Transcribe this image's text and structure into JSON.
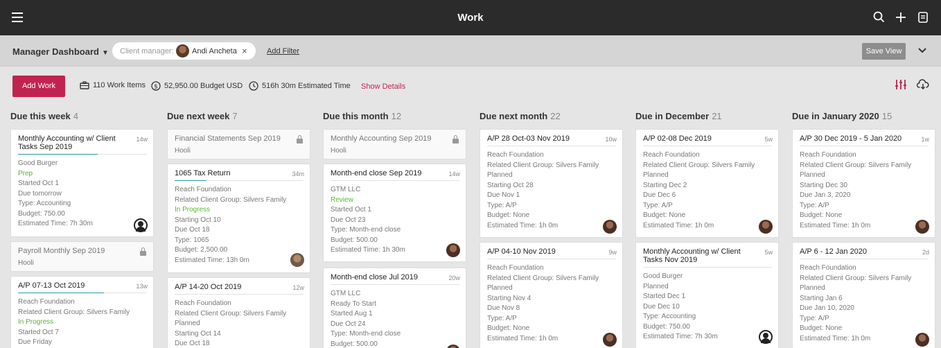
{
  "header": {
    "title": "Work"
  },
  "filterbar": {
    "view_name": "Manager Dashboard",
    "chip_label": "Client manager:",
    "chip_value": "Andi Ancheta",
    "add_filter": "Add Filter",
    "save_view": "Save View"
  },
  "actions": {
    "add_work": "Add Work",
    "work_items": "110 Work Items",
    "budget": "52,950.00 Budget USD",
    "estimated": "516h 30m Estimated Time",
    "show_details": "Show Details"
  },
  "colors": {
    "accent": "#c1234f",
    "progress": "#2c9aa6",
    "status_green": "#5ab433"
  },
  "columns": [
    {
      "title": "Due this week",
      "count": "4",
      "cards": [
        {
          "title": "Monthly Accounting w/ Client Tasks Sep 2019",
          "dur": "14w",
          "lines": [
            "Good Burger",
            "Prep",
            "Started Oct 1",
            "Due tomorrow",
            "Type: Accounting",
            "Budget: 750.00",
            "Estimated Time: 7h 30m"
          ]
        },
        {
          "title": "Payroll Monthly Sep 2019",
          "lines": [
            "Hooli"
          ]
        },
        {
          "title": "A/P 07-13 Oct 2019",
          "dur": "13w",
          "lines": [
            "Reach Foundation",
            "Related Client Group: Silvers Family",
            "In Progress",
            "Started Oct 7",
            "Due Friday"
          ]
        }
      ]
    },
    {
      "title": "Due next week",
      "count": "7",
      "cards": [
        {
          "title": "Financial Statements Sep 2019",
          "lines": [
            "Hooli"
          ]
        },
        {
          "title": "1065 Tax Return",
          "dur": "34m",
          "lines": [
            "Reach Foundation",
            "Related Client Group: Silvers Family",
            "In Progress",
            "Starting Oct 10",
            "Due Oct 18",
            "Type: 1065",
            "Budget: 2,500.00",
            "Estimated Time: 13h 0m"
          ]
        },
        {
          "title": "A/P 14-20 Oct 2019",
          "dur": "12w",
          "lines": [
            "Reach Foundation",
            "Related Client Group: Silvers Family",
            "Planned",
            "Starting Oct 14",
            "Due Oct 18"
          ]
        }
      ]
    },
    {
      "title": "Due this month",
      "count": "12",
      "cards": [
        {
          "title": "Monthly Accounting Sep 2019",
          "lines": [
            "Hooli"
          ]
        },
        {
          "title": "Month-end close Sep 2019",
          "dur": "14w",
          "lines": [
            "GTM LLC",
            "Review",
            "Started Oct 1",
            "Due Oct 23",
            "Type: Month-end close",
            "Budget: 500.00",
            "Estimated Time: 1h 30m"
          ]
        },
        {
          "title": "Month-end close Jul 2019",
          "dur": "20w",
          "lines": [
            "GTM LLC",
            "Ready To Start",
            "Started Aug 1",
            "Due Oct 24",
            "Type: Month-end close",
            "Budget: 500.00"
          ]
        }
      ]
    },
    {
      "title": "Due next month",
      "count": "22",
      "cards": [
        {
          "title": "A/P 28 Oct-03 Nov 2019",
          "dur": "10w",
          "lines": [
            "Reach Foundation",
            "Related Client Group: Silvers Family",
            "Planned",
            "Starting Oct 28",
            "Due Nov 1",
            "Type: A/P",
            "Budget: None",
            "Estimated Time: 1h 0m"
          ]
        },
        {
          "title": "A/P 04-10 Nov 2019",
          "dur": "9w",
          "lines": [
            "Reach Foundation",
            "Related Client Group: Silvers Family",
            "Planned",
            "Starting Nov 4",
            "Due Nov 8",
            "Type: A/P",
            "Budget: None",
            "Estimated Time: 1h 0m"
          ]
        }
      ]
    },
    {
      "title": "Due in December",
      "count": "21",
      "cards": [
        {
          "title": "A/P 02-08 Dec 2019",
          "dur": "5w",
          "lines": [
            "Reach Foundation",
            "Related Client Group: Silvers Family",
            "Planned",
            "Starting Dec 2",
            "Due Dec 6",
            "Type: A/P",
            "Budget: None",
            "Estimated Time: 1h 0m"
          ]
        },
        {
          "title": "Monthly Accounting w/ Client Tasks Nov 2019",
          "dur": "5w",
          "lines": [
            "Good Burger",
            "Planned",
            "Started Dec 1",
            "Due Dec 10",
            "Type: Accounting",
            "Budget: 750.00",
            "Estimated Time: 7h 30m"
          ]
        }
      ]
    },
    {
      "title": "Due in January 2020",
      "count": "15",
      "cards": [
        {
          "title": "A/P 30 Dec 2019 - 5 Jan 2020",
          "dur": "1w",
          "lines": [
            "Reach Foundation",
            "Related Client Group: Silvers Family",
            "Planned",
            "Starting Dec 30",
            "Due Jan 3, 2020",
            "Type: A/P",
            "Budget: None",
            "Estimated Time: 1h 0m"
          ]
        },
        {
          "title": "A/P 6 - 12 Jan 2020",
          "dur": "2d",
          "lines": [
            "Reach Foundation",
            "Related Client Group: Silvers Family",
            "Planned",
            "Starting Jan 6",
            "Due Jan 10, 2020",
            "Type: A/P",
            "Budget: None",
            "Estimated Time: 1h 0m"
          ]
        }
      ]
    }
  ]
}
